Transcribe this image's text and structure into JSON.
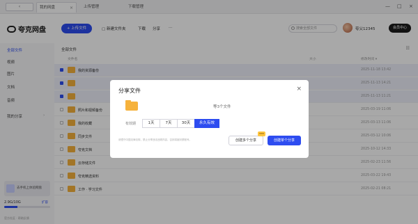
{
  "tabs": {
    "back_label": "‹",
    "items": [
      {
        "label": "我的网盘",
        "active": true
      },
      {
        "label": "上传管理",
        "active": false
      },
      {
        "label": "下载管理",
        "active": false
      }
    ],
    "close_glyph": "×",
    "window_controls": [
      "—",
      "□",
      "×"
    ]
  },
  "header": {
    "logo_text": "夸克网盘",
    "upload_label": "+ 上传文件",
    "new_folder_label": "新建文件夹",
    "download_label": "下载",
    "share_label": "分享",
    "more_label": "···",
    "search_placeholder": "搜索全部文件",
    "username": "夸父12345",
    "vip_label": "会员中心"
  },
  "sidebar": {
    "items": [
      {
        "label": "全部文件",
        "active": true
      },
      {
        "label": "视频",
        "active": false
      },
      {
        "label": "图片",
        "active": false
      },
      {
        "label": "文档",
        "active": false
      },
      {
        "label": "音频",
        "active": false
      },
      {
        "label": "我的分享",
        "active": false
      }
    ],
    "promo_text": "去手机上体验网盘",
    "quota_text": "2.9G/10G",
    "quota_vip": "扩容",
    "quota_fraction": 0.29,
    "footer_text": "官方社区 · 帮助反馈"
  },
  "main": {
    "breadcrumb": "全部文件",
    "view_icon": "☷",
    "columns": {
      "name": "文件名",
      "size": "大小",
      "modified": "修改时间 ▾"
    },
    "rows": [
      {
        "name": "我的资源备份",
        "date": "2025-11-18 13:42",
        "selected": true
      },
      {
        "name": "",
        "date": "2025-11-13 14:21",
        "selected": true
      },
      {
        "name": "",
        "date": "2025-11-13 11:21",
        "selected": true
      },
      {
        "name": "照片和视频备份",
        "date": "2025-03-19 11:06",
        "selected": false
      },
      {
        "name": "我的收藏",
        "date": "2025-03-13 11:06",
        "selected": false
      },
      {
        "name": "同步文件",
        "date": "2025-03-12 10:06",
        "selected": false
      },
      {
        "name": "夸克文档",
        "date": "2025-10-12 14:33",
        "selected": false
      },
      {
        "name": "云存储文件",
        "date": "2025-02-23 11:56",
        "selected": false
      },
      {
        "name": "夸克精选资料",
        "date": "2025-03-22 19:43",
        "selected": false
      },
      {
        "name": "工作 · 学习文件",
        "date": "2025-02-21 08:21",
        "selected": false
      }
    ]
  },
  "dialog": {
    "title": "分享文件",
    "close": "×",
    "file_count_text": "等3个文件",
    "validity_label": "有效期",
    "periods": [
      {
        "label": "1天",
        "active": false
      },
      {
        "label": "7天",
        "active": false
      },
      {
        "label": "30天",
        "active": false
      },
      {
        "label": "永久有效",
        "active": true
      }
    ],
    "note": "请遵守中国法律法规，禁止分享违法违规内容，否则将被封禁账号。",
    "multi_btn_label": "创建多个分享",
    "multi_badge": "new",
    "single_btn_label": "创建单个分享"
  }
}
